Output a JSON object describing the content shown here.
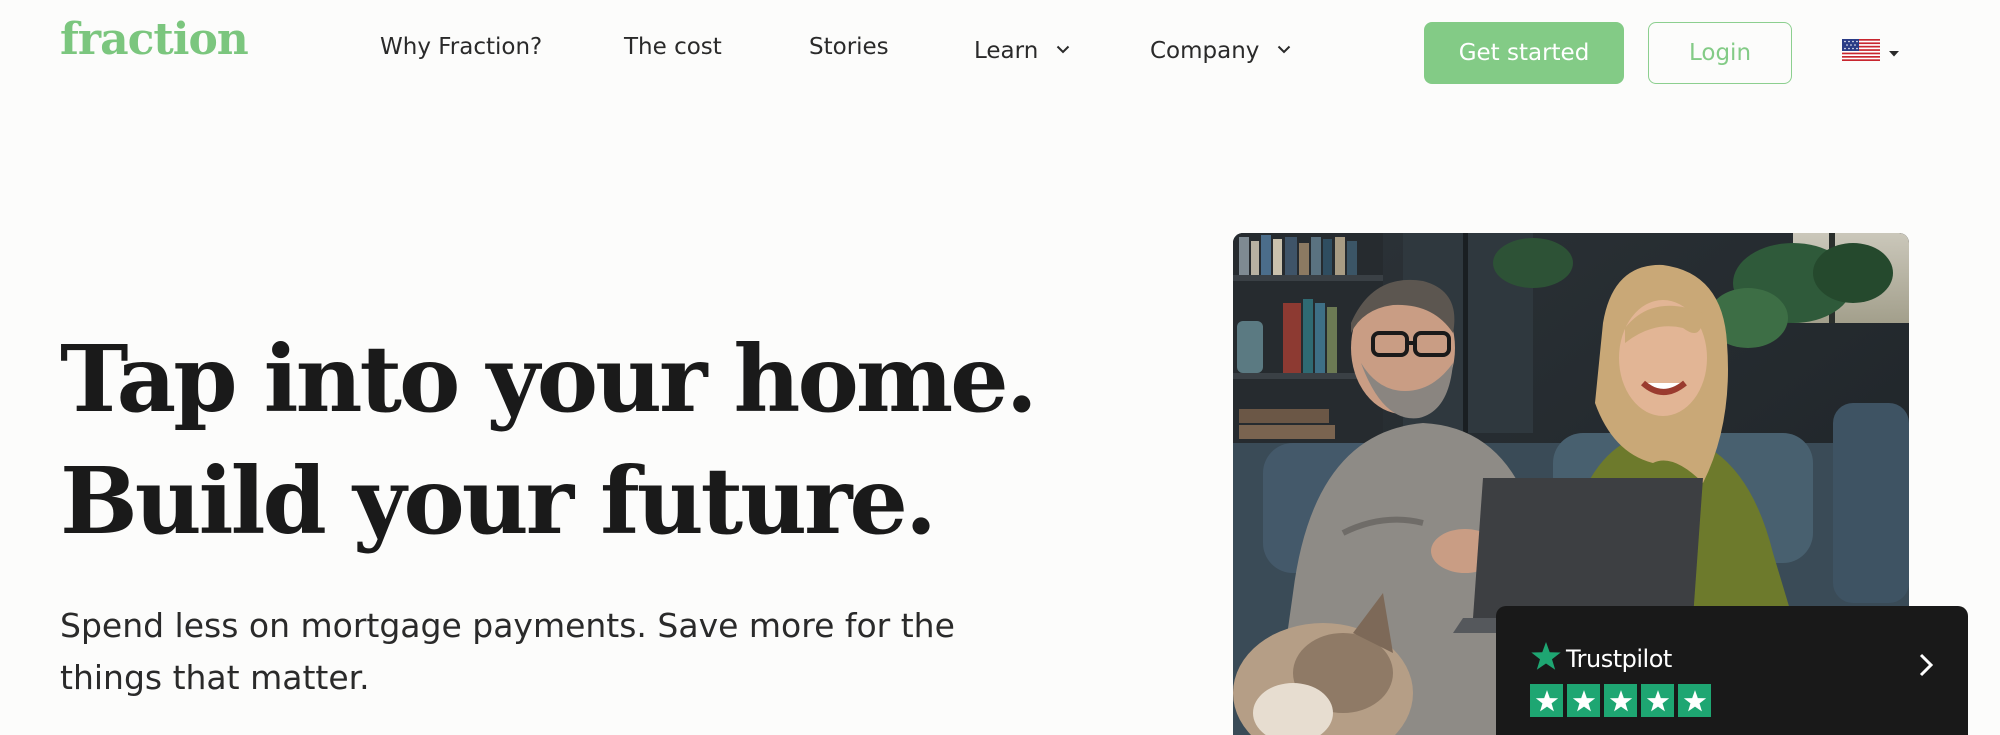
{
  "brand": {
    "logo_text": "fraction",
    "accent_color": "#83cb86"
  },
  "nav": {
    "items": [
      {
        "label": "Why Fraction?",
        "has_dropdown": false
      },
      {
        "label": "The cost",
        "has_dropdown": false
      },
      {
        "label": "Stories",
        "has_dropdown": false
      },
      {
        "label": "Learn",
        "has_dropdown": true
      },
      {
        "label": "Company",
        "has_dropdown": true
      }
    ],
    "get_started_label": "Get started",
    "login_label": "Login",
    "language_icon": "us-flag-icon"
  },
  "hero": {
    "headline_line1": "Tap into your home.",
    "headline_line2": "Build your future.",
    "subtext": "Spend less on mortgage payments. Save more for the things that matter.",
    "image_icon": "couple-with-laptop-photo"
  },
  "trustpilot": {
    "brand_label": "Trustpilot",
    "star_count": 5,
    "star_color": "#1ea672"
  }
}
